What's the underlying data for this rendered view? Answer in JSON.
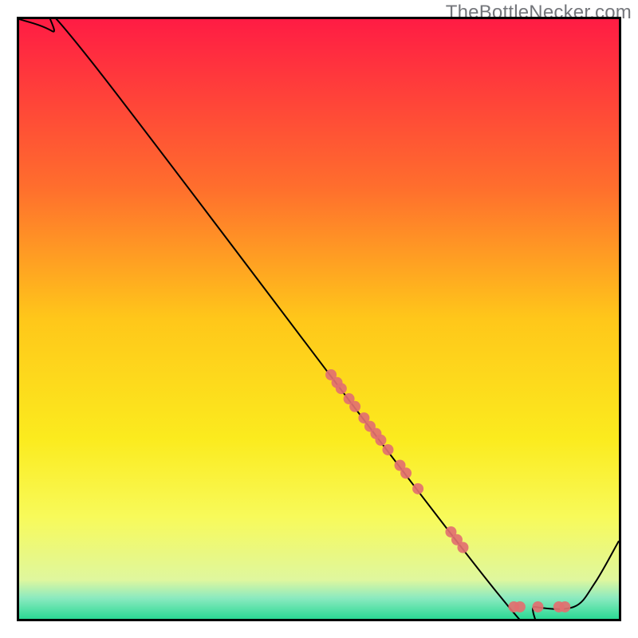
{
  "watermark": "TheBottleNecker.com",
  "chart_data": {
    "type": "line",
    "title": "",
    "xlabel": "",
    "ylabel": "",
    "xlim": [
      0,
      100
    ],
    "ylim": [
      0,
      100
    ],
    "background_gradient": {
      "stops": [
        {
          "offset": 0,
          "color": "#ff1c44"
        },
        {
          "offset": 0.28,
          "color": "#ff6e2d"
        },
        {
          "offset": 0.5,
          "color": "#ffc71a"
        },
        {
          "offset": 0.7,
          "color": "#fbeb1e"
        },
        {
          "offset": 0.83,
          "color": "#f8fa5a"
        },
        {
          "offset": 0.935,
          "color": "#dff79e"
        },
        {
          "offset": 0.965,
          "color": "#8ceac0"
        },
        {
          "offset": 1.0,
          "color": "#2bd994"
        }
      ]
    },
    "series": [
      {
        "name": "curve",
        "type": "line",
        "color": "#000000",
        "width": 2,
        "x": [
          0,
          5.5,
          12,
          80,
          86,
          92.5,
          96,
          100
        ],
        "y": [
          100,
          98,
          93,
          4,
          2,
          2,
          6,
          13
        ]
      },
      {
        "name": "points",
        "type": "scatter",
        "color": "#e27070",
        "radius": 7,
        "x": [
          52.0,
          53.0,
          53.7,
          55.0,
          56.0,
          57.5,
          58.5,
          59.5,
          60.3,
          61.5,
          63.5,
          64.5,
          66.5,
          72.0,
          73.0,
          74.0,
          82.5,
          83.5,
          86.5,
          90.0,
          91.0
        ],
        "y": [
          40.7,
          39.4,
          38.4,
          36.7,
          35.4,
          33.5,
          32.1,
          30.9,
          29.8,
          28.2,
          25.6,
          24.3,
          21.7,
          14.5,
          13.2,
          11.9,
          2.0,
          2.0,
          2.0,
          2.0,
          2.0
        ]
      }
    ]
  }
}
